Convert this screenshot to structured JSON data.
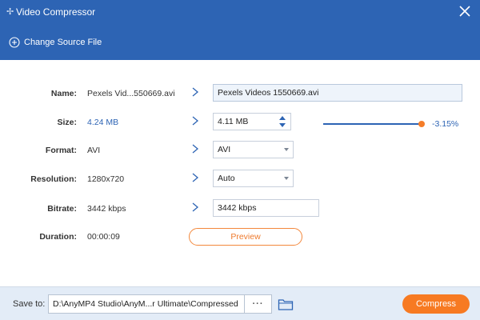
{
  "window": {
    "title": "Video Compressor",
    "app_icon": "sparkle-icon",
    "close_icon": "close-icon"
  },
  "source": {
    "change_label": "Change Source File",
    "icon": "plus-circle-icon"
  },
  "labels": {
    "name": "Name:",
    "size": "Size:",
    "format": "Format:",
    "resolution": "Resolution:",
    "bitrate": "Bitrate:",
    "duration": "Duration:"
  },
  "source_values": {
    "name": "Pexels Vid...550669.avi",
    "size": "4.24 MB",
    "format": "AVI",
    "resolution": "1280x720",
    "bitrate": "3442 kbps",
    "duration": "00:00:09"
  },
  "output": {
    "name": "Pexels Videos 1550669.avi",
    "size": "4.11 MB",
    "format": "AVI",
    "resolution": "Auto",
    "bitrate": "3442 kbps"
  },
  "compression": {
    "percent_label": "-3.15%",
    "slider_level": 1.0
  },
  "preview_label": "Preview",
  "footer": {
    "save_to_label": "Save to:",
    "path": "D:\\AnyMP4 Studio\\AnyM...r Ultimate\\Compressed",
    "browse_label": "···",
    "folder_icon": "folder-icon",
    "compress_label": "Compress"
  },
  "colors": {
    "accent": "#2d64b4",
    "orange": "#f77a22",
    "footer_bg": "#e3ecf7"
  }
}
